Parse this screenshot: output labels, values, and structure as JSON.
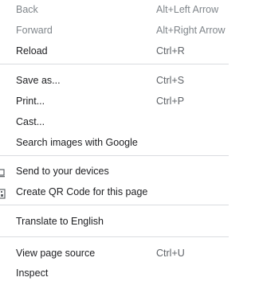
{
  "menu": {
    "back": {
      "label": "Back",
      "shortcut": "Alt+Left Arrow"
    },
    "forward": {
      "label": "Forward",
      "shortcut": "Alt+Right Arrow"
    },
    "reload": {
      "label": "Reload",
      "shortcut": "Ctrl+R"
    },
    "save_as": {
      "label": "Save as...",
      "shortcut": "Ctrl+S"
    },
    "print": {
      "label": "Print...",
      "shortcut": "Ctrl+P"
    },
    "cast": {
      "label": "Cast..."
    },
    "search_images": {
      "label": "Search images with Google"
    },
    "send_to_devices": {
      "label": "Send to your devices",
      "icon": "devices-icon"
    },
    "qr_code": {
      "label": "Create QR Code for this page",
      "icon": "qr-code-icon"
    },
    "translate": {
      "label": "Translate to English"
    },
    "view_source": {
      "label": "View page source",
      "shortcut": "Ctrl+U"
    },
    "inspect": {
      "label": "Inspect"
    }
  }
}
